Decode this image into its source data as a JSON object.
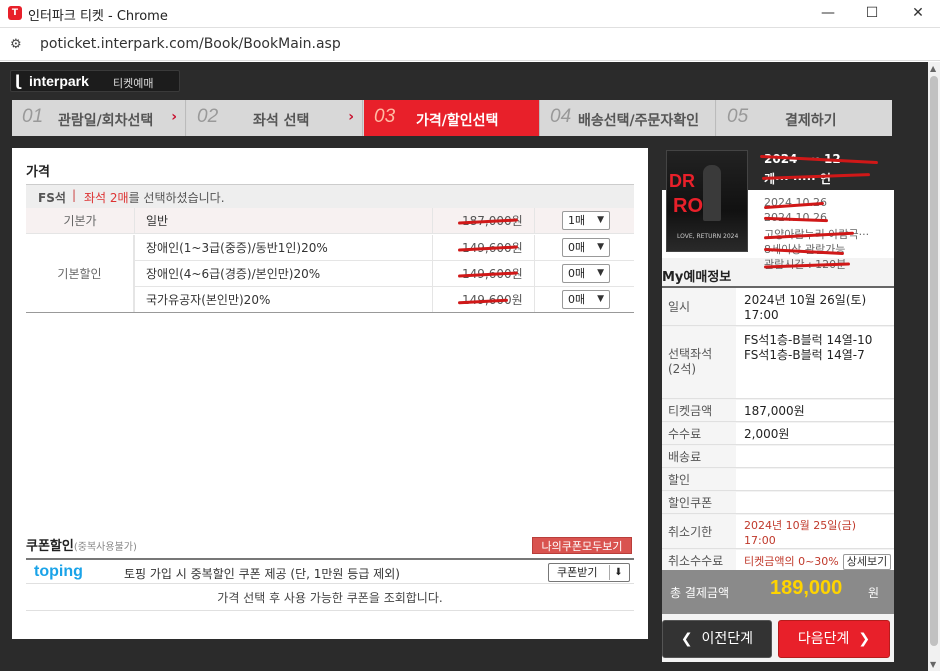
{
  "window": {
    "title": "인터파크 티켓 - Chrome",
    "url": "poticket.interpark.com/Book/BookMain.asp",
    "icon_text": "T"
  },
  "header": {
    "brand": "interpark",
    "sub": "티켓예매"
  },
  "steps": [
    {
      "num": "01",
      "label": "관람일/회차선택",
      "active": false
    },
    {
      "num": "02",
      "label": "좌석 선택",
      "active": false
    },
    {
      "num": "03",
      "label": "가격/할인선택",
      "active": true
    },
    {
      "num": "04",
      "label": "배송선택/주문자확인",
      "active": false
    },
    {
      "num": "05",
      "label": "결제하기",
      "active": false
    }
  ],
  "price": {
    "title": "가격",
    "grade": "FS석",
    "sep": "|",
    "msg_pre": "좌석 2매",
    "msg_post": "를 선택하셨습니다.",
    "rows": [
      {
        "cat": "기본가",
        "name": "일반",
        "price": "187,000원",
        "qty": "1매"
      },
      {
        "cat": "",
        "name": "장애인(1~3급(중증)/동반1인)20%",
        "price": "149,600원",
        "qty": "0매"
      },
      {
        "cat": "",
        "name": "장애인(4~6급(경증)/본인만)20%",
        "price": "149,600원",
        "qty": "0매"
      },
      {
        "cat": "",
        "name": "국가유공자(본인만)20%",
        "price": "149,600원",
        "qty": "0매"
      }
    ],
    "group_label": "기본할인"
  },
  "coupon": {
    "title": "쿠폰할인",
    "note": "(중복사용불가)",
    "my_coupon_btn": "나의쿠폰모두보기",
    "toping_logo": "toping",
    "toping_text": "토핑 가입 시 중복할인 쿠폰 제공 (단, 1만원 등급 제외)",
    "toping_btn": "쿠폰받기",
    "msg": "가격 선택 후 사용 가능한 쿠폰을 조회합니다."
  },
  "show": {
    "title1": "2024 ···· 12",
    "title2": "케··· ····· 연",
    "lines": [
      "2024.10.26",
      "2024.10.26",
      "고양아람누리 아람극···",
      "8세이상 관람가능",
      "관람시간 : 120분"
    ],
    "poster_text1": "DR",
    "poster_text2": "RO",
    "poster_caption": "LOVE, RETURN 2024"
  },
  "myinfo": {
    "title": "My예매정보",
    "rows": [
      {
        "k": "일시",
        "v": "2024년 10월 26일(토)\n17:00"
      },
      {
        "k": "선택좌석\n(2석)",
        "v": "FS석1층-B블럭 14열-10\nFS석1층-B블럭 14열-7"
      },
      {
        "k": "티켓금액",
        "v": "187,000원"
      },
      {
        "k": "수수료",
        "v": "2,000원"
      },
      {
        "k": "배송료",
        "v": ""
      },
      {
        "k": "할인",
        "v": ""
      },
      {
        "k": "할인쿠폰",
        "v": ""
      },
      {
        "k": "취소기한",
        "v": "2024년 10월 25일(금)\n17:00"
      },
      {
        "k": "취소수수료",
        "v": "티켓금액의 0~30%"
      }
    ],
    "detail_btn": "상세보기",
    "total_label": "총 결제금액",
    "total_value": "189,000",
    "total_unit": "원"
  },
  "nav": {
    "prev": "이전단계",
    "next": "다음단계"
  },
  "colors": {
    "accent": "#e8202a",
    "dark": "#2b2b2b",
    "gold": "#ffd400"
  }
}
